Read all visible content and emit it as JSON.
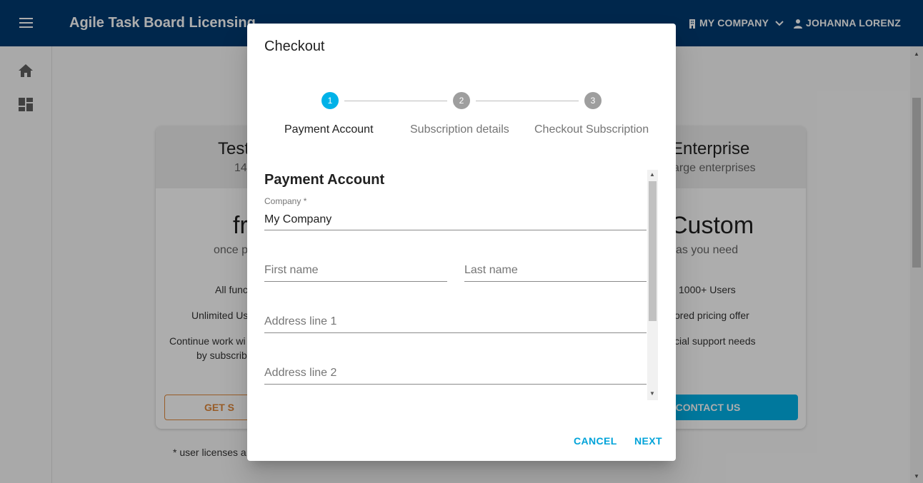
{
  "appbar": {
    "title": "Agile Task Board Licensing",
    "company_label": "MY COMPANY",
    "user_label": "JOHANNA LORENZ"
  },
  "colors": {
    "appbar": "#003a70",
    "accent": "#00b2e8",
    "orange": "#e0883a",
    "step_active": "#00b2e8",
    "step_inactive": "#9e9e9e"
  },
  "background": {
    "left_card": {
      "title": "Test",
      "subtitle": "14",
      "price": "fr",
      "price_sub": "once p",
      "features": [
        "All func",
        "Unlimited Us",
        "Continue work wi",
        "by subscrib"
      ],
      "button_label": "GET S"
    },
    "right_card": {
      "title": "Enterprise",
      "subtitle": "arge enterprises",
      "price": "Custom",
      "price_sub": "as you need",
      "features": [
        "1000+ Users",
        "ored pricing offer",
        "cial support needs"
      ],
      "button_label": "CONTACT US"
    },
    "footnote": "* user licenses a"
  },
  "dialog": {
    "title": "Checkout",
    "steps": [
      {
        "number": "1",
        "label": "Payment Account",
        "active": true
      },
      {
        "number": "2",
        "label": "Subscription details",
        "active": false
      },
      {
        "number": "3",
        "label": "Checkout Subscription",
        "active": false
      }
    ],
    "section_title": "Payment Account",
    "fields": {
      "company": {
        "label": "Company *",
        "value": "My Company"
      },
      "first_name": {
        "placeholder": "First name"
      },
      "last_name": {
        "placeholder": "Last name"
      },
      "address1": {
        "placeholder": "Address line 1"
      },
      "address2": {
        "placeholder": "Address line 2"
      }
    },
    "actions": {
      "cancel": "CANCEL",
      "next": "NEXT"
    }
  }
}
